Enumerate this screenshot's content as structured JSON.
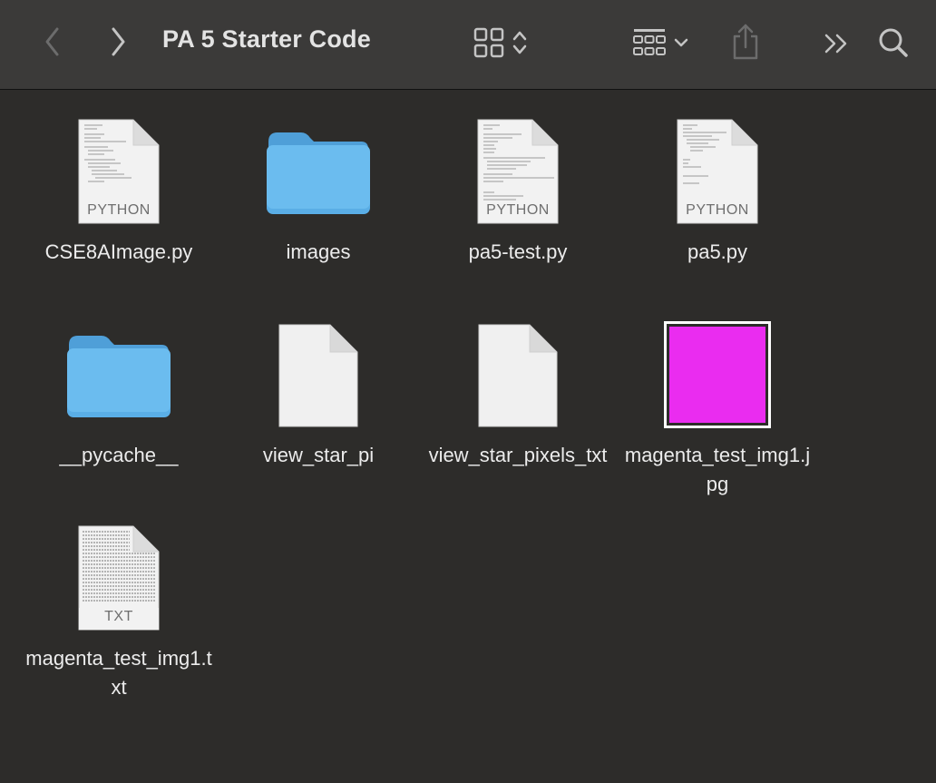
{
  "window": {
    "title": "PA 5 Starter Code"
  },
  "toolbar": {
    "back_icon": "chevron-left-icon",
    "forward_icon": "chevron-right-icon",
    "view_icon": "grid-view-icon",
    "group_icon": "group-by-icon",
    "share_icon": "share-icon",
    "more_icon": "more-toolbar-icon",
    "search_icon": "search-icon"
  },
  "colors": {
    "folder": "#66b7ee",
    "image_fill": "#ea2cf0",
    "background": "#2d2c2a",
    "toolbar": "#3b3a39"
  },
  "files": [
    {
      "name": "CSE8AImage.py",
      "kind": "python",
      "badge": "PYTHON"
    },
    {
      "name": "images",
      "kind": "folder",
      "badge": ""
    },
    {
      "name": "pa5-test.py",
      "kind": "python",
      "badge": "PYTHON"
    },
    {
      "name": "pa5.py",
      "kind": "python",
      "badge": "PYTHON"
    },
    {
      "name": "__pycache__",
      "kind": "folder",
      "badge": ""
    },
    {
      "name": "view_star_pi",
      "kind": "blank",
      "badge": ""
    },
    {
      "name": "view_star_pixels_txt",
      "kind": "blank",
      "badge": ""
    },
    {
      "name": "magenta_test_img1.jpg",
      "kind": "image",
      "badge": ""
    },
    {
      "name": "magenta_test_img1.txt",
      "kind": "text",
      "badge": "TXT"
    }
  ]
}
